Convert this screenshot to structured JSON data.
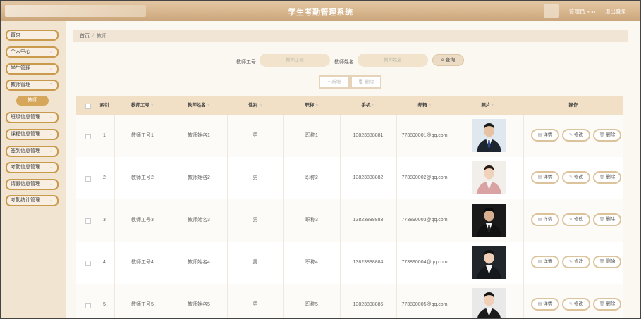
{
  "header": {
    "title": "学生考勤管理系统",
    "user_text": "管理员 abo",
    "logout": "退出登录"
  },
  "sidebar": {
    "items": [
      {
        "label": "首页",
        "chevron": false
      },
      {
        "label": "个人中心",
        "chevron": true
      },
      {
        "label": "学生管理",
        "chevron": true
      },
      {
        "label": "教师管理",
        "chevron": true
      },
      {
        "label": "班级信息管理",
        "chevron": true
      },
      {
        "label": "课程信息管理",
        "chevron": true
      },
      {
        "label": "签到信息管理",
        "chevron": true
      },
      {
        "label": "考勤信息管理",
        "chevron": true
      },
      {
        "label": "请假信息管理",
        "chevron": true
      },
      {
        "label": "考勤统计管理",
        "chevron": true
      }
    ],
    "active_sub": "教师"
  },
  "breadcrumb": {
    "home": "首页",
    "separator": "/",
    "current": "教师"
  },
  "search": {
    "id_label": "教师工号",
    "id_placeholder": "教师工号",
    "name_label": "教师姓名",
    "name_placeholder": "教师姓名",
    "query_button": "查询"
  },
  "actions": {
    "add": "新增",
    "delete": "删除"
  },
  "table": {
    "headers": {
      "index": "索引",
      "teacher_id": "教师工号",
      "teacher_name": "教师姓名",
      "gender": "性别",
      "title": "职称",
      "phone": "手机",
      "email": "邮箱",
      "photo": "照片",
      "ops": "操作"
    },
    "op_labels": {
      "detail": "详情",
      "edit": "修改",
      "delete": "删除"
    },
    "rows": [
      {
        "index": "1",
        "teacher_id": "教师工号1",
        "teacher_name": "教师姓名1",
        "gender": "男",
        "title": "职称1",
        "phone": "13823888881",
        "email": "773890001@qq.com"
      },
      {
        "index": "2",
        "teacher_id": "教师工号2",
        "teacher_name": "教师姓名2",
        "gender": "男",
        "title": "职称2",
        "phone": "13823888882",
        "email": "773890002@qq.com"
      },
      {
        "index": "3",
        "teacher_id": "教师工号3",
        "teacher_name": "教师姓名3",
        "gender": "男",
        "title": "职称3",
        "phone": "13823888883",
        "email": "773890003@qq.com"
      },
      {
        "index": "4",
        "teacher_id": "教师工号4",
        "teacher_name": "教师姓名4",
        "gender": "男",
        "title": "职称4",
        "phone": "13823888884",
        "email": "773890004@qq.com"
      },
      {
        "index": "5",
        "teacher_id": "教师工号5",
        "teacher_name": "教师姓名5",
        "gender": "男",
        "title": "职称5",
        "phone": "13823888885",
        "email": "773890005@qq.com"
      }
    ]
  },
  "colors": {
    "accent": "#d6a75a",
    "header": "#d8b68d",
    "nav_border": "#c99a4c",
    "table_head": "#f1e0c6"
  }
}
